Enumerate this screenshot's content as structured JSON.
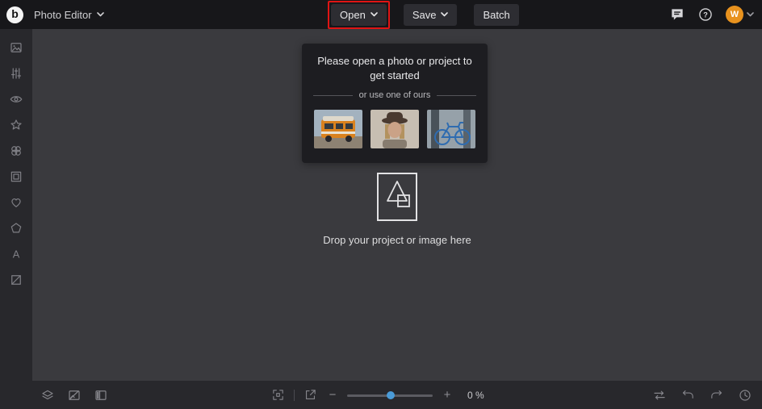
{
  "colors": {
    "topbar_bg": "#17171a",
    "panel_bg": "#28282c",
    "canvas_bg": "#3a3a3e",
    "popup_bg": "#1d1d21",
    "accent_blue": "#4a9bd8",
    "avatar_bg": "#e8921e",
    "annotation_red": "#e01414"
  },
  "topbar": {
    "app_title": "Photo Editor",
    "logo_letter": "b",
    "buttons": {
      "open": "Open",
      "save": "Save",
      "batch": "Batch"
    },
    "avatar_initial": "W",
    "icons": [
      "comment-icon",
      "help-icon",
      "avatar",
      "chevron-down-icon"
    ]
  },
  "sidebar": {
    "tools": [
      "arrange",
      "adjust",
      "retouch",
      "effect",
      "filter",
      "frame",
      "favorites",
      "shapes",
      "text",
      "cutout"
    ]
  },
  "welcome_popup": {
    "title_line1": "Please open a photo or project to",
    "title_line2": "get started",
    "divider_text": "or use one of ours",
    "samples": [
      "orange-van-photo",
      "woman-portrait-photo",
      "blue-bicycle-photo"
    ]
  },
  "drop_zone": {
    "label": "Drop your project or image here"
  },
  "bottombar": {
    "zoom_value": "0 %",
    "left_icons": [
      "layers-icon",
      "preview-icon",
      "panels-icon"
    ],
    "mid_icons": [
      "fit-screen-icon",
      "fullscreen-window-icon"
    ],
    "right_icons": [
      "toggle-loop-icon",
      "undo-icon",
      "redo-icon",
      "history-icon"
    ]
  }
}
